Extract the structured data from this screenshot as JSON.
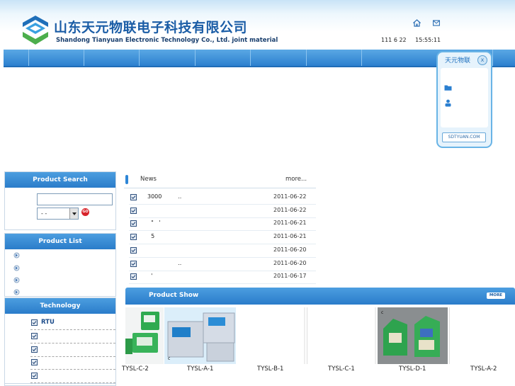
{
  "header": {
    "company_cn": "山东天元物联电子科技有限公司",
    "company_en": "Shandong Tianyuan Electronic Technology Co., Ltd. joint material",
    "date": "111 6 22",
    "time": "15:55:11",
    "icons": [
      "home-icon",
      "mail-icon"
    ]
  },
  "float_panel": {
    "title": "天元物联",
    "close": "x",
    "footer": "SDTYUAN.COM",
    "icons": [
      "folder-icon",
      "user-icon"
    ]
  },
  "sidebar": {
    "product_search": {
      "title": "Product Search",
      "input_value": "",
      "select_value": "- -",
      "go_label": "GO"
    },
    "product_list": {
      "title": "Product List",
      "items": [
        "",
        "",
        "",
        ""
      ]
    },
    "technology": {
      "title": "Technology",
      "items": [
        "RTU",
        "",
        "",
        "",
        ""
      ]
    }
  },
  "news": {
    "title": "News",
    "more": "more...",
    "items": [
      {
        "text": "3000         ..",
        "date": "2011-06-22"
      },
      {
        "text": "",
        "date": "2011-06-22"
      },
      {
        "text": "  \"   '",
        "date": "2011-06-21"
      },
      {
        "text": "  5",
        "date": "2011-06-21"
      },
      {
        "text": "",
        "date": "2011-06-20"
      },
      {
        "text": "                 ..",
        "date": "2011-06-20"
      },
      {
        "text": "  '",
        "date": "2011-06-17"
      }
    ]
  },
  "product_show": {
    "title": "Product Show",
    "more": "MORE",
    "items": [
      {
        "label": "TYSL-C-2"
      },
      {
        "label": "TYSL-A-1"
      },
      {
        "label": "TYSL-B-1"
      },
      {
        "label": "TYSL-C-1"
      },
      {
        "label": "TYSL-D-1"
      },
      {
        "label": "TYSL-A-2"
      }
    ]
  },
  "colors": {
    "nav_blue": "#2c80cf",
    "header_blue": "#1b5da6",
    "accent_red": "#d8242b"
  }
}
